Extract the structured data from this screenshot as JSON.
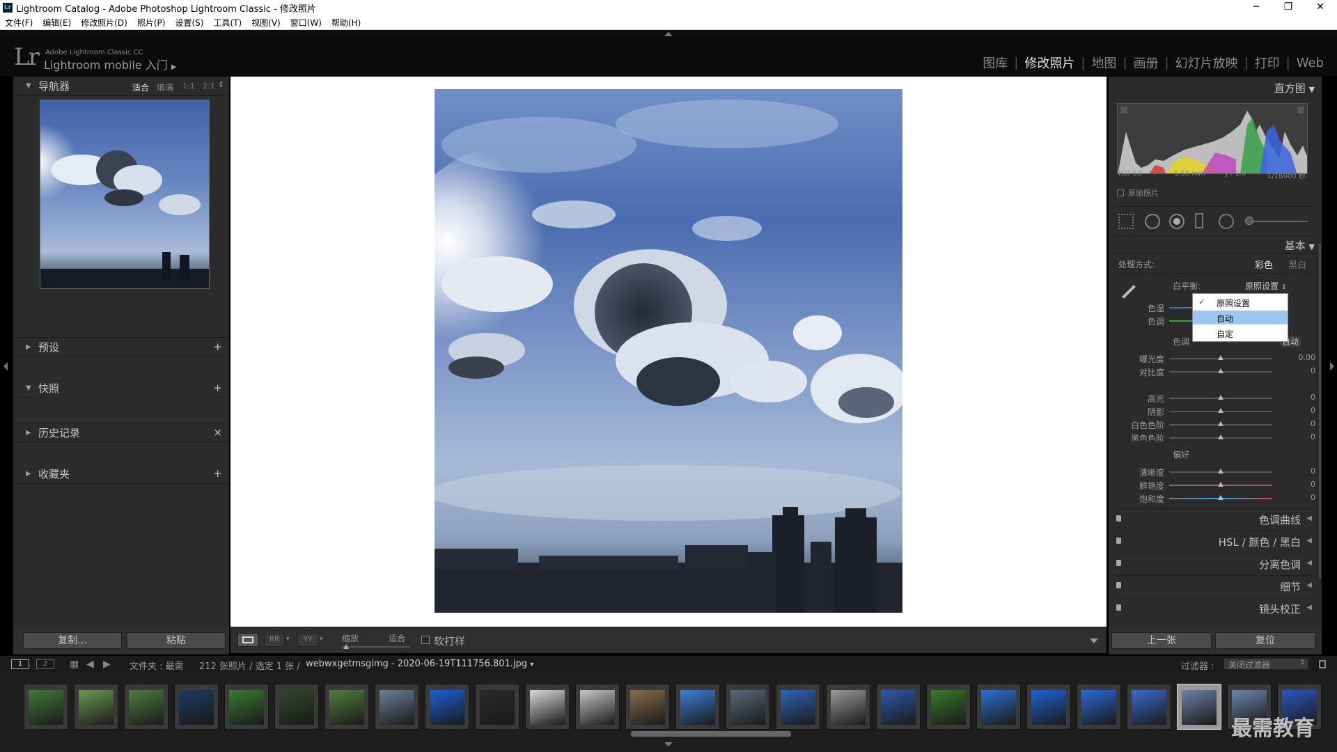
{
  "window": {
    "title": "Lightroom Catalog - Adobe Photoshop Lightroom Classic - 修改照片"
  },
  "menu": [
    "文件(F)",
    "编辑(E)",
    "修改照片(D)",
    "照片(P)",
    "设置(S)",
    "工具(T)",
    "视图(V)",
    "窗口(W)",
    "帮助(H)"
  ],
  "identity": {
    "logo": "Lr",
    "product": "Adobe Lightroom Classic CC",
    "mobile": "Lightroom mobile 入门",
    "arrow": "▶"
  },
  "modules": [
    "图库",
    "修改照片",
    "地图",
    "画册",
    "幻灯片放映",
    "打印",
    "Web"
  ],
  "active_module": "修改照片",
  "left": {
    "navigator": {
      "title": "导航器",
      "zoom": [
        "适合",
        "填满",
        "1:1",
        "2:1"
      ]
    },
    "sections": [
      {
        "title": "预设",
        "action": "+"
      },
      {
        "title": "快照",
        "action": "+"
      },
      {
        "title": "历史记录",
        "action": "×"
      },
      {
        "title": "收藏夹",
        "action": "+"
      }
    ],
    "copy_label": "复制...",
    "paste_label": "粘贴"
  },
  "right": {
    "histogram": {
      "title": "直方图",
      "iso": "ISO 50",
      "focal": "5.58 mm",
      "aperture": "ƒ / 1.8",
      "shutter": "1/16000 秒",
      "original_label": "原始照片"
    },
    "basic": {
      "title": "基本",
      "treatment_label": "处理方式:",
      "treatment_color": "彩色",
      "treatment_bw": "黑白",
      "wb_label": "白平衡:",
      "wb_value": "原照设置",
      "wb_options": [
        "原照设置",
        "自动",
        "自定"
      ],
      "temp_label": "色温",
      "tint_label": "色调",
      "tone_label": "色调",
      "auto_label": "自动",
      "tone_sliders": [
        {
          "label": "曝光度",
          "value": "0.00"
        },
        {
          "label": "对比度",
          "value": "0"
        },
        {
          "label": "高光",
          "value": "0"
        },
        {
          "label": "阴影",
          "value": "0"
        },
        {
          "label": "白色色阶",
          "value": "0"
        },
        {
          "label": "黑色色阶",
          "value": "0"
        }
      ],
      "presence_label": "偏好",
      "presence_sliders": [
        {
          "label": "清晰度",
          "value": "0"
        },
        {
          "label": "鲜艳度",
          "value": "0"
        },
        {
          "label": "饱和度",
          "value": "0"
        }
      ]
    },
    "panels": [
      "色调曲线",
      "HSL  /  颜色  /  黑白",
      "分离色调",
      "细节",
      "镜头校正"
    ],
    "prev_label": "上一张",
    "reset_label": "复位"
  },
  "toolbar": {
    "zoom_label": "缩放",
    "fit_label": "适合",
    "softproof_label": "软打样"
  },
  "filmbar": {
    "page1": "1",
    "page2": "2",
    "folder": "文件夹 : 最需",
    "count": "212 张照片 / 选定 1 张 /",
    "filename": "webwxgetmsgimg - 2020-06-19T111756.801.jpg",
    "filter_label": "过滤器 :",
    "filter_value": "关闭过滤器"
  },
  "filmstrip_colors": [
    "#3f7a3a",
    "#6c9a50",
    "#4e7d3e",
    "#1c3a66",
    "#3a7a33",
    "#2f4a2a",
    "#4f7f3d",
    "#6a7f98",
    "#1d5fd6",
    "#2a2a2a",
    "#d8d8d8",
    "#c6c6c6",
    "#8a6a4a",
    "#3d7ed8",
    "#5a6a7a",
    "#2f64b8",
    "#9a9a9a",
    "#2d5aa5",
    "#3a7a28",
    "#2e6fd0",
    "#1e62d6",
    "#2a6ad6",
    "#3c6ad0",
    "#6c82a6",
    "#6d86b0",
    "#2a58c0"
  ],
  "selected_index": 23,
  "watermark": "最需教育"
}
